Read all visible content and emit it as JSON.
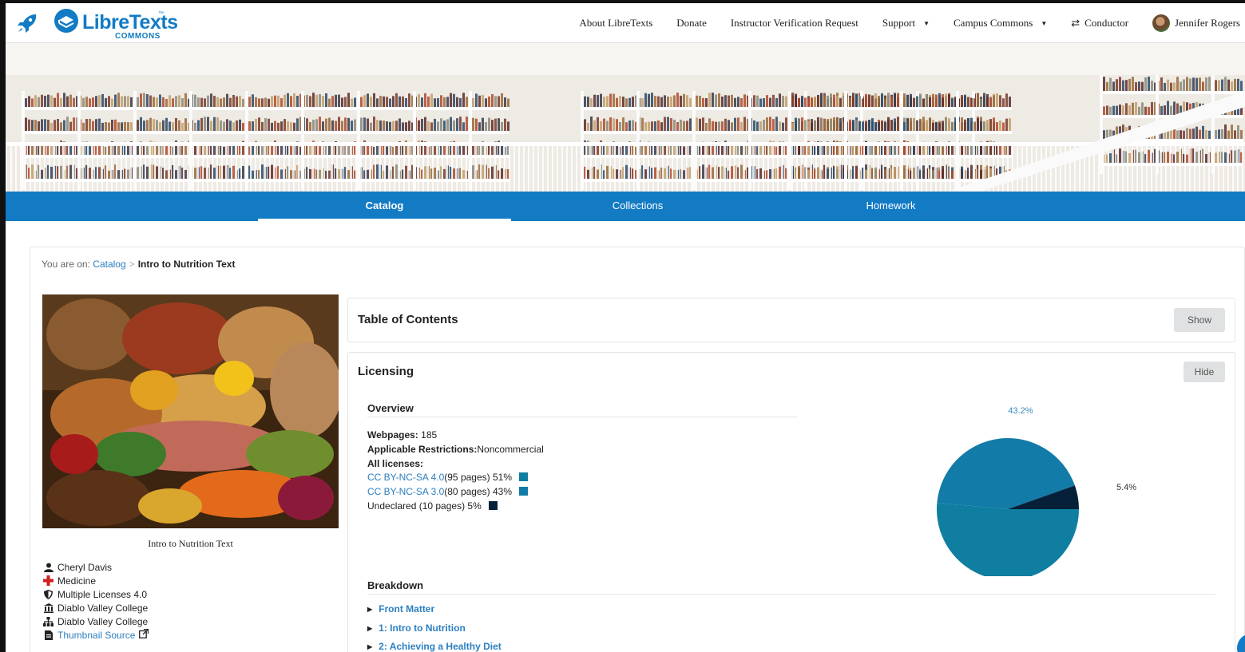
{
  "app": {
    "logo_name": "LibreTexts",
    "logo_sub": "COMMONS",
    "logo_tm": "™"
  },
  "nav": {
    "about": "About LibreTexts",
    "donate": "Donate",
    "verification": "Instructor Verification Request",
    "support": "Support",
    "campus": "Campus Commons",
    "conductor": "Conductor",
    "user": "Jennifer Rogers"
  },
  "tabs": [
    {
      "label": "Catalog",
      "active": true
    },
    {
      "label": "Collections",
      "active": false
    },
    {
      "label": "Homework",
      "active": false
    }
  ],
  "breadcrumb": {
    "prefix": "You are on:",
    "catalog": "Catalog",
    "current": "Intro to Nutrition Text"
  },
  "book": {
    "title": "Intro to Nutrition Text",
    "author": "Cheryl Davis",
    "subject": "Medicine",
    "license": "Multiple Licenses 4.0",
    "institution": "Diablo Valley College",
    "campus": "Diablo Valley College",
    "thumbnail_source": "Thumbnail Source"
  },
  "toc": {
    "title": "Table of Contents",
    "button": "Show"
  },
  "licensing": {
    "title": "Licensing",
    "button": "Hide",
    "overview_heading": "Overview",
    "webpages_label": "Webpages:",
    "webpages_value": "185",
    "restrictions_label": "Applicable Restrictions:",
    "restrictions_value": "Noncommercial",
    "all_licenses_label": "All licenses:",
    "licenses": [
      {
        "name": "CC BY-NC-SA 4.0",
        "detail": "(95 pages) 51%",
        "color": "#0f7ea0",
        "link": true
      },
      {
        "name": "CC BY-NC-SA 3.0",
        "detail": "(80 pages) 43%",
        "color": "#127ba8",
        "link": true
      },
      {
        "name": "Undeclared",
        "detail": " (10 pages) 5%",
        "color": "#07203a",
        "link": false
      }
    ],
    "breakdown_heading": "Breakdown",
    "breakdown": [
      "Front Matter",
      "1: Intro to Nutrition",
      "2: Achieving a Healthy Diet"
    ]
  },
  "chart_data": {
    "type": "pie",
    "slices": [
      {
        "label": "51.4%",
        "value": 51.4,
        "color": "#0f7ea0"
      },
      {
        "label": "43.2%",
        "value": 43.2,
        "color": "#127ba8"
      },
      {
        "label": "5.4%",
        "value": 5.4,
        "color": "#07203a"
      }
    ]
  },
  "icons": {
    "author": "user-icon",
    "subject": "medical-cross-icon",
    "license": "shield-icon",
    "institution": "institution-icon",
    "campus": "sitemap-icon",
    "thumbnail": "file-icon",
    "external": "external-link-icon"
  },
  "colors": {
    "brand": "#127BC4",
    "link": "#2c7fc0"
  }
}
